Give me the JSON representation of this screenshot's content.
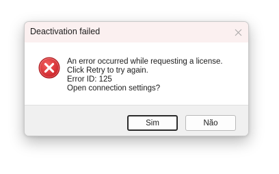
{
  "dialog": {
    "title": "Deactivation failed",
    "close_icon": "close-icon",
    "icon": "error-icon",
    "message_lines": [
      "An error occurred while requesting a license.",
      "Click Retry to try again.",
      "Error ID: 125",
      "Open connection settings?"
    ],
    "buttons": {
      "yes_label": "Sim",
      "no_label": "Não"
    }
  },
  "colors": {
    "titlebar_bg": "#fbf0f0",
    "footer_bg": "#f0f0f0",
    "error_red": "#d8292f"
  }
}
